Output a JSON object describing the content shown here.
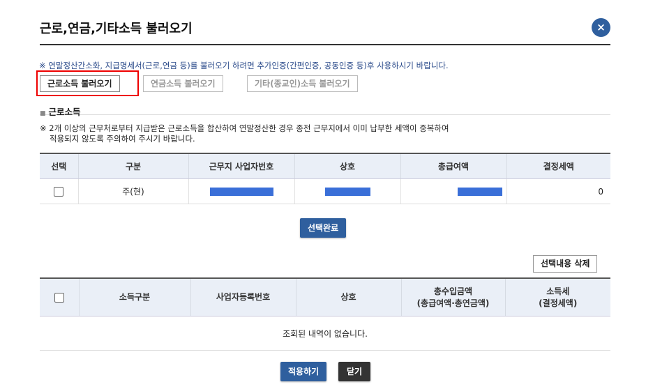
{
  "dialog": {
    "title": "근로,연금,기타소득 불러오기",
    "close_icon": "×"
  },
  "notice": "※ 연말정산간소화, 지급명세서(근로,연금 등)를 불러오기 하려면 추가인증(간편인증, 공동인증 등)후 사용하시기 바랍니다.",
  "load_buttons": {
    "earned": "근로소득 불러오기",
    "pension": "연금소득 불러오기",
    "other": "기타(종교인)소득 불러오기"
  },
  "section": {
    "title": "근로소득",
    "warning_line1": "※ 2개 이상의 근무처로부터 지급받은 근로소득을 합산하여 연말정산한 경우 종전 근무지에서 이미 납부한 세액이 중복하여",
    "warning_line2": "적용되지 않도록 주의하여 주시기 바랍니다."
  },
  "income_table": {
    "headers": [
      "선택",
      "구분",
      "근무지 사업자번호",
      "상호",
      "총급여액",
      "결정세액"
    ],
    "rows": [
      {
        "type": "주(현)",
        "business_no": "",
        "company": "",
        "total_pay": "",
        "decided_tax": "0"
      }
    ]
  },
  "select_done_label": "선택완료",
  "delete_selected_label": "선택내용 삭제",
  "result_table": {
    "headers": [
      "소득구분",
      "사업자등록번호",
      "상호",
      "총수입금액",
      "(총급여액·총연금액)",
      "소득세",
      "(결정세액)"
    ],
    "empty_message": "조회된 내역이 없습니다."
  },
  "footer": {
    "apply_label": "적용하기",
    "close_label": "닫기"
  },
  "colors": {
    "primary": "#2f5f9e",
    "highlight_outline": "#ee0000",
    "masked_value": "#3a6fd8"
  }
}
